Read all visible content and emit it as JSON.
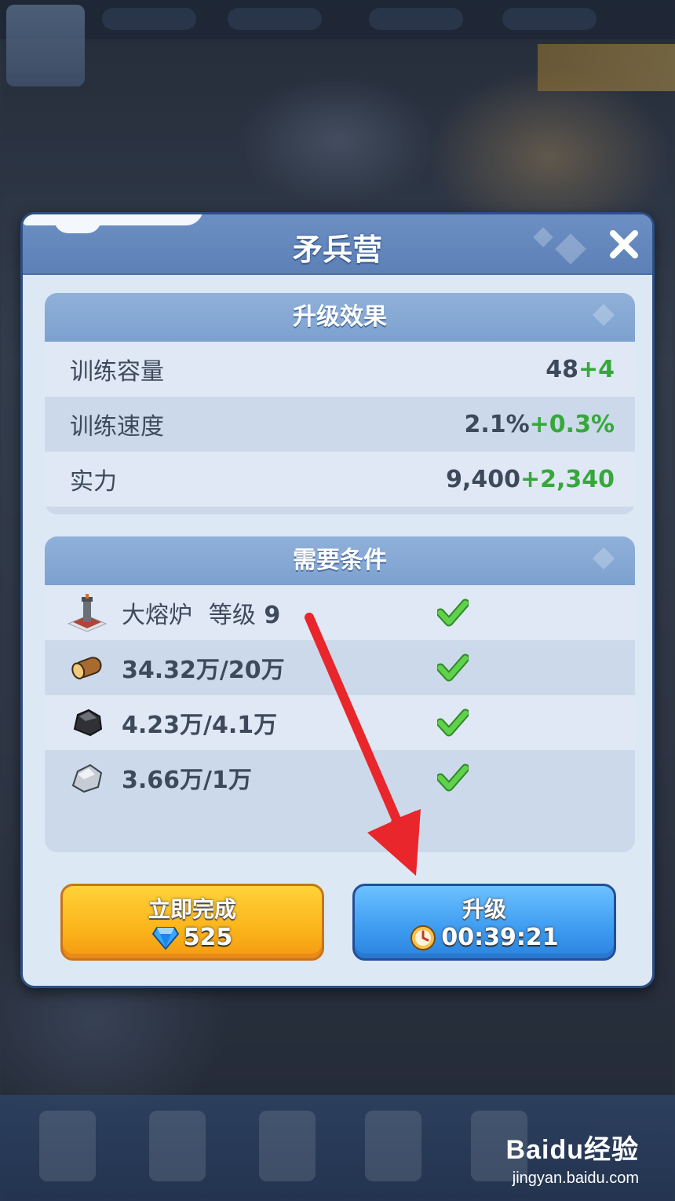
{
  "dialog": {
    "title": "矛兵营",
    "close_icon": "close-x-icon"
  },
  "effects": {
    "header": "升级效果",
    "rows": [
      {
        "label": "训练容量",
        "base": "48",
        "bonus": "+4"
      },
      {
        "label": "训练速度",
        "base": "2.1%",
        "bonus": "+0.3%"
      },
      {
        "label": "实力",
        "base": "9,400",
        "bonus": "+2,340"
      }
    ]
  },
  "requirements": {
    "header": "需要条件",
    "items": [
      {
        "icon": "furnace-icon",
        "name": "大熔炉",
        "level_label": "等级",
        "level": "9",
        "met": true
      },
      {
        "icon": "wood-log-icon",
        "amount": "34.32万/20万",
        "met": true
      },
      {
        "icon": "coal-icon",
        "amount": "4.23万/4.1万",
        "met": true
      },
      {
        "icon": "iron-ore-icon",
        "amount": "3.66万/1万",
        "met": true
      }
    ]
  },
  "buttons": {
    "finish_now": {
      "label": "立即完成",
      "cost": "525",
      "icon": "gem-icon"
    },
    "upgrade": {
      "label": "升级",
      "time": "00:39:21",
      "icon": "clock-icon"
    }
  },
  "colors": {
    "bonus_green": "#36a83a",
    "dialog_bg": "#dde8f5",
    "header_blue": "#6c8fc4",
    "finish_yellow": "#fbb41a",
    "upgrade_blue": "#3d9bf0",
    "arrow_red": "#e8262b"
  },
  "watermark": {
    "brand": "Baidu经验",
    "url": "jingyan.baidu.com"
  }
}
